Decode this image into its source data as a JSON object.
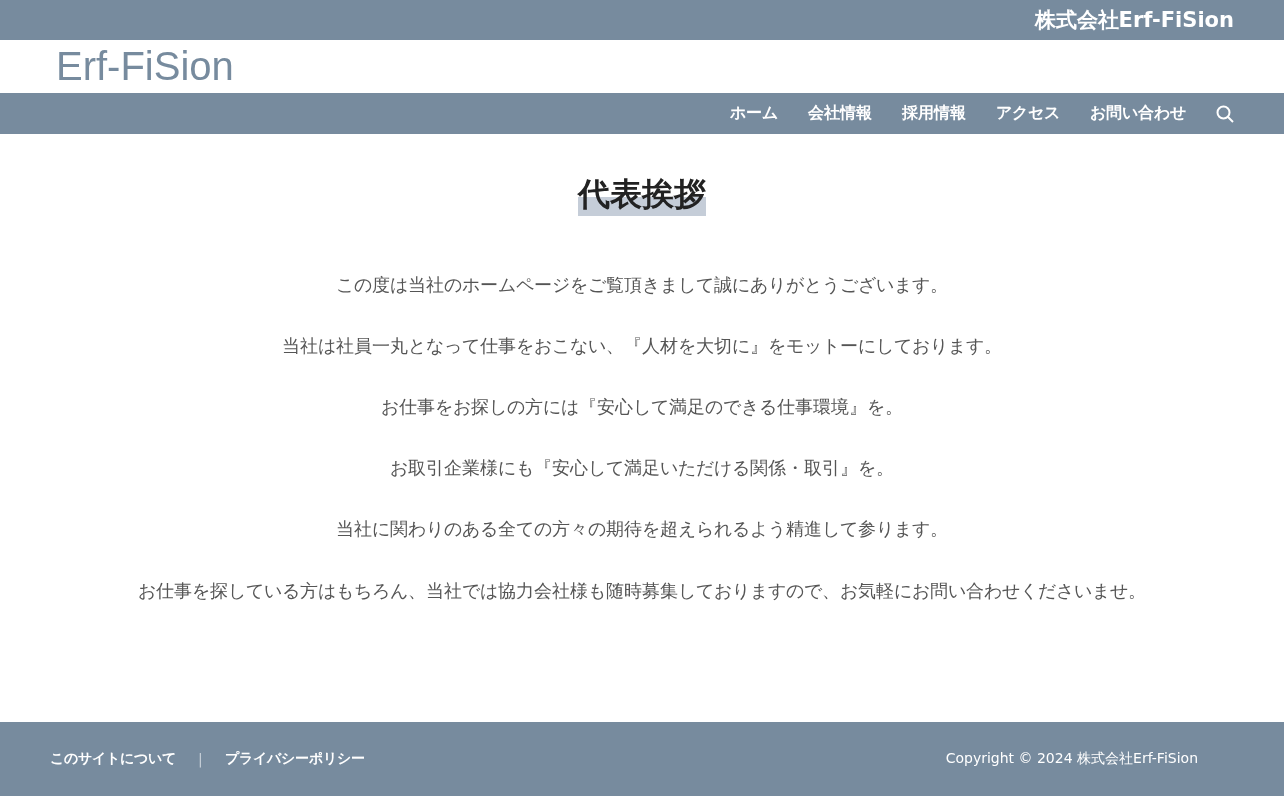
{
  "top_bar": {
    "company": "株式会社Erf-FiSion"
  },
  "header": {
    "logo": "Erf-FiSion"
  },
  "nav": {
    "items": [
      {
        "label": "ホーム"
      },
      {
        "label": "会社情報"
      },
      {
        "label": "採用情報"
      },
      {
        "label": "アクセス"
      },
      {
        "label": "お問い合わせ"
      }
    ]
  },
  "main": {
    "title": "代表挨拶",
    "paragraphs": [
      "この度は当社のホームページをご覧頂きまして誠にありがとうございます。",
      "当社は社員一丸となって仕事をおこない、『人材を大切に』をモットーにしております。",
      "お仕事をお探しの方には『安心して満足のできる仕事環境』を。",
      "お取引企業様にも『安心して満足いただける関係・取引』を。",
      "当社に関わりのある全ての方々の期待を超えられるよう精進して参ります。",
      "お仕事を探している方はもちろん、当社では協力会社様も随時募集しておりますので、お気軽にお問い合わせくださいませ。"
    ]
  },
  "footer": {
    "links": [
      "このサイトについて",
      "プライバシーポリシー"
    ],
    "separator": "|",
    "copyright": "Copyright © 2024 株式会社Erf-FiSion"
  }
}
